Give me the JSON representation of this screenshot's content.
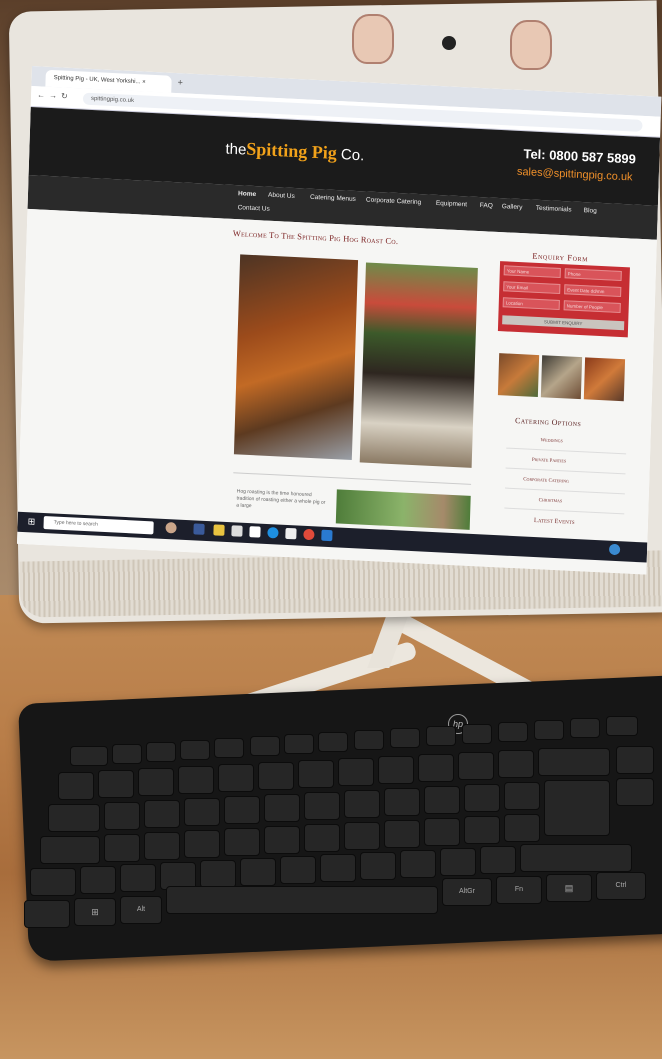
{
  "browser": {
    "tab_title": "Spitting Pig - UK, West Yorkshi... ×",
    "url": "spittingpig.co.uk"
  },
  "site": {
    "logo_prefix": "the",
    "logo_main": "Spitting Pig",
    "logo_suffix": "Co.",
    "tel": "Tel: 0800 587 5899",
    "email": "sales@spittingpig.co.uk",
    "nav": [
      "Home",
      "About Us",
      "Catering Menus",
      "Corporate Catering",
      "Equipment",
      "FAQ",
      "Gallery",
      "Testimonials",
      "Blog",
      "Contact Us"
    ],
    "welcome": "Welcome To The Spitting Pig Hog Roast Co.",
    "body_text": "Hog roasting is the time honoured tradition of roasting either a whole pig or a large",
    "enquiry": {
      "title": "Enquiry Form",
      "fields": [
        "Your Name",
        "Phone",
        "Your Email",
        "Event Date dd/mm",
        "Location",
        "Number of People"
      ],
      "submit": "SUBMIT ENQUIRY"
    },
    "catering": {
      "title": "Catering Options",
      "items": [
        "Weddings",
        "Private Parties",
        "Corporate Catering",
        "Christmas",
        "Latest Events"
      ]
    }
  },
  "taskbar": {
    "search_placeholder": "Type here to search"
  },
  "keyboard": {
    "keys": [
      "AltGr",
      "Fn",
      "Ctrl",
      "Alt"
    ]
  },
  "colors": {
    "accent_red": "#c62e33",
    "logo_orange": "#f2a21a",
    "header_dark": "#1b1b1b"
  }
}
